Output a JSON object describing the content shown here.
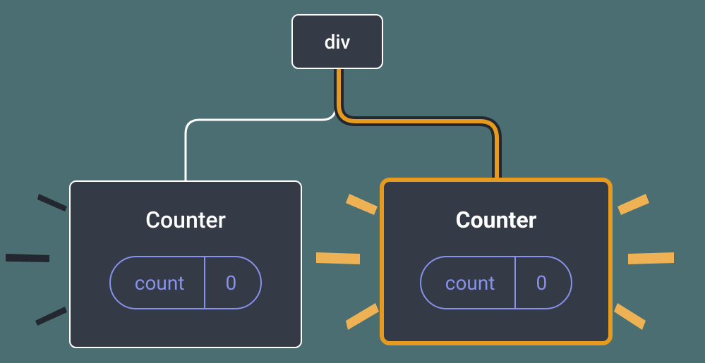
{
  "tree": {
    "root": {
      "label": "div"
    },
    "children": [
      {
        "title": "Counter",
        "state": {
          "label": "count",
          "value": "0"
        },
        "highlighted": false
      },
      {
        "title": "Counter",
        "state": {
          "label": "count",
          "value": "0"
        },
        "highlighted": true
      }
    ]
  },
  "colors": {
    "background": "#4a6e72",
    "panel": "#343a46",
    "outline": "#ffffff",
    "highlight": "#e69b1f",
    "purple": "#8891ec",
    "dark": "#23272f"
  }
}
